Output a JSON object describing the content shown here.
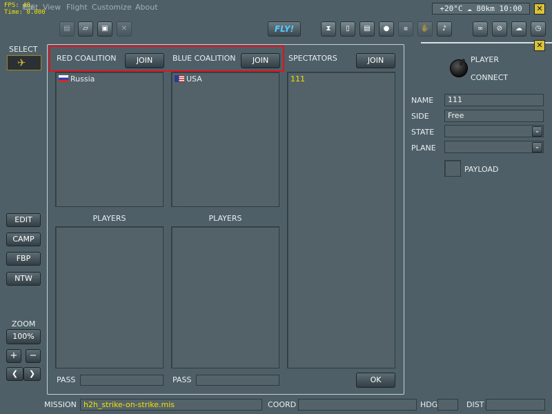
{
  "hud": {
    "fps": "FPS: 40",
    "time": "Time: 0.000"
  },
  "menu": [
    "File",
    "Edit",
    "View",
    "Flight",
    "Customize",
    "About"
  ],
  "weather": "+20°C ☁ 80km 10:00",
  "toolbar": {
    "fly_label": "FLY!"
  },
  "left": {
    "select_label": "SELECT",
    "edit": "EDIT",
    "camp": "CAMP",
    "fbp": "FBP",
    "ntw": "NTW",
    "zoom_label": "ZOOM",
    "zoom_value": "100%",
    "zoom_in": "+",
    "zoom_out": "−",
    "prev": "❮",
    "next": "❯"
  },
  "coalitions": {
    "red": {
      "title": "RED COALITION",
      "join": "JOIN",
      "countries": [
        "Russia"
      ],
      "players_label": "PLAYERS",
      "pass_label": "PASS"
    },
    "blue": {
      "title": "BLUE COALITION",
      "join": "JOIN",
      "countries": [
        "USA"
      ],
      "players_label": "PLAYERS",
      "pass_label": "PASS"
    },
    "spectators": {
      "title": "SPECTATORS",
      "join": "JOIN",
      "entries": [
        "111"
      ]
    },
    "ok_label": "OK"
  },
  "player": {
    "player_label": "PLAYER",
    "connect_label": "CONNECT",
    "name_label": "NAME",
    "name_value": "111",
    "side_label": "SIDE",
    "side_value": "Free",
    "state_label": "STATE",
    "state_value": "",
    "plane_label": "PLANE",
    "plane_value": "",
    "payload_label": "PAYLOAD"
  },
  "status": {
    "mission_label": "MISSION",
    "mission_value": "h2h_strike-on-strike.mis",
    "coord_label": "COORD",
    "coord_value": "",
    "hdg_label": "HDG",
    "hdg_value": "",
    "dist_label": "DIST",
    "dist_value": ""
  },
  "colors": {
    "accent_red": "#e8101a",
    "spectator_text": "#f2e300",
    "fly_text": "#55c8ff",
    "mission_text": "#f2e300"
  }
}
